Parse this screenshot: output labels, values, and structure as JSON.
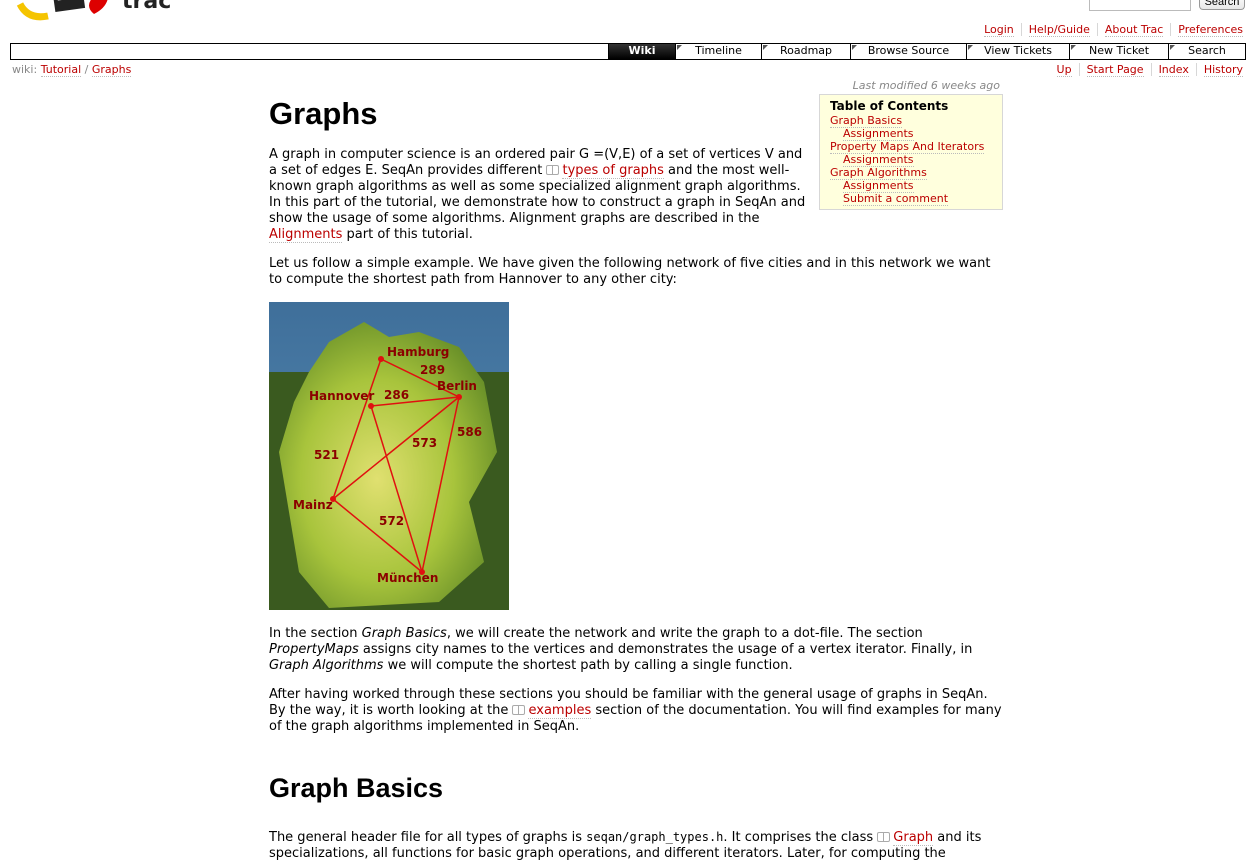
{
  "header": {
    "search_button": "Search",
    "metanav": [
      "Login",
      "Help/Guide",
      "About Trac",
      "Preferences"
    ]
  },
  "mainnav": {
    "tabs": [
      {
        "label": "Wiki",
        "active": true
      },
      {
        "label": "Timeline",
        "active": false
      },
      {
        "label": "Roadmap",
        "active": false
      },
      {
        "label": "Browse Source",
        "active": false
      },
      {
        "label": "View Tickets",
        "active": false
      },
      {
        "label": "New Ticket",
        "active": false
      },
      {
        "label": "Search",
        "active": false
      }
    ]
  },
  "breadcrumb": {
    "prefix": "wiki:",
    "parent": "Tutorial",
    "separator": "/",
    "current": "Graphs"
  },
  "ctxtnav": [
    "Up",
    "Start Page",
    "Index",
    "History"
  ],
  "last_modified": "Last modified 6 weeks ago",
  "toc": {
    "title": "Table of Contents",
    "items": [
      {
        "label": "Graph Basics",
        "level": 1
      },
      {
        "label": "Assignments",
        "level": 2
      },
      {
        "label": "Property Maps And Iterators",
        "level": 1
      },
      {
        "label": "Assignments",
        "level": 2
      },
      {
        "label": "Graph Algorithms",
        "level": 1
      },
      {
        "label": "Assignments",
        "level": 2
      },
      {
        "label": "Submit a comment",
        "level": 2
      }
    ]
  },
  "page": {
    "title": "Graphs",
    "p1": {
      "a": "A graph in computer science is an ordered pair G =(V,E) of a set of vertices V and a set of edges E. SeqAn provides different ",
      "link1": "types of graphs",
      "b": " and the most well-known graph algorithms as well as some specialized alignment graph algorithms. In this part of the tutorial, we demonstrate how to construct a graph in SeqAn and show the usage of some algorithms. Alignment graphs are described in the ",
      "link2": "Alignments",
      "c": " part of this tutorial."
    },
    "p2": "Let us follow a simple example. We have given the following network of five cities and in this network we want to compute the shortest path from Hannover to any other city:",
    "p3": {
      "a": "In the section ",
      "em1": "Graph Basics",
      "b": ", we will create the network and write the graph to a dot-file. The section ",
      "em2": "PropertyMaps",
      "c": " assigns city names to the vertices and demonstrates the usage of a vertex iterator. Finally, in ",
      "em3": "Graph Algorithms",
      "d": " we will compute the shortest path by calling a single function."
    },
    "p4": {
      "a": "After having worked through these sections you should be familiar with the general usage of graphs in SeqAn. By the way, it is worth looking at the ",
      "link": "examples",
      "b": " section of the documentation. You will find examples for many of the graph algorithms implemented in SeqAn."
    },
    "h2": "Graph Basics",
    "p5": {
      "a": "The general header file for all types of graphs is ",
      "code": "seqan/graph_types.h",
      "b": ". It comprises the class ",
      "link": "Graph",
      "c": " and its specializations, all functions for basic graph operations, and different iterators. Later, for computing the"
    }
  },
  "map": {
    "cities": [
      "Hamburg",
      "Berlin",
      "Hannover",
      "Mainz",
      "München"
    ],
    "weights": [
      "289",
      "286",
      "573",
      "586",
      "521",
      "572"
    ]
  }
}
